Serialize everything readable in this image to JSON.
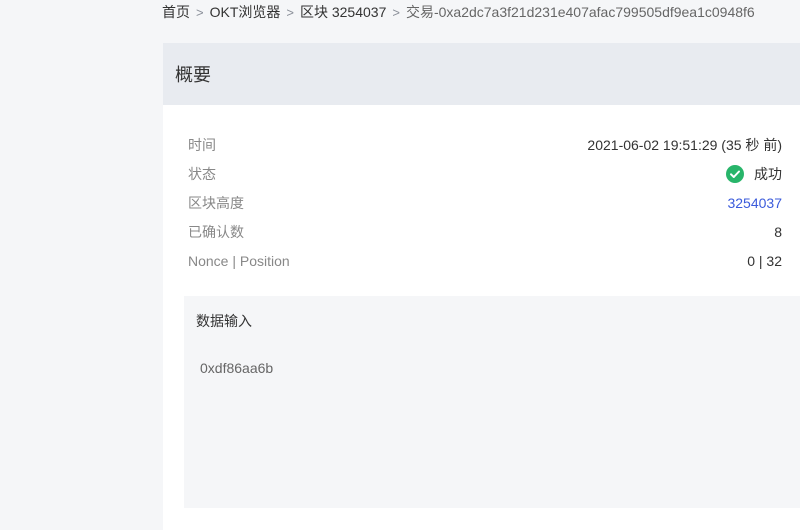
{
  "breadcrumb": {
    "home": "首页",
    "explorer": "OKT浏览器",
    "block": "区块 3254037",
    "tx": "交易-0xa2dc7a3f21d231e407afac799505df9ea1c0948f6",
    "separator": ">"
  },
  "overview": {
    "title": "概要",
    "rows": [
      {
        "label": "时间",
        "value": "2021-06-02 19:51:29 (35 秒 前)"
      },
      {
        "label": "状态",
        "value": "成功"
      },
      {
        "label": "区块高度",
        "value": "3254037"
      },
      {
        "label": "已确认数",
        "value": "8"
      },
      {
        "label": "Nonce | Position",
        "value": "0 | 32"
      }
    ]
  },
  "data_input": {
    "title": "数据输入",
    "value": "0xdf86aa6b"
  },
  "colors": {
    "accent_link": "#3b5bdb",
    "success": "#28b56a",
    "header_bg": "#e8ebf0",
    "page_bg": "#f5f6f8"
  },
  "icons": {
    "status": "check-circle-icon"
  }
}
